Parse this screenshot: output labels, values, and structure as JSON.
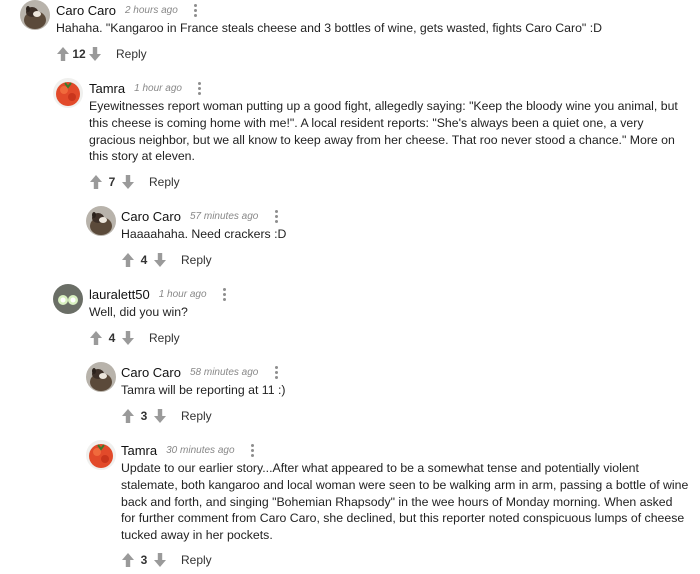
{
  "comments": [
    {
      "author": "Caro Caro",
      "time": "2 hours ago",
      "text": "Hahaha. \"Kangaroo in France steals cheese and 3 bottles of wine, gets wasted, fights Caro Caro\" :D",
      "votes": "12",
      "reply": "Reply",
      "avatar": "kangaroo-avatar"
    },
    {
      "author": "Tamra",
      "time": "1 hour ago",
      "text": "Eyewitnesses report woman putting up a good fight, allegedly saying: \"Keep the bloody wine you animal, but this cheese is coming home with me!\". A local resident reports: \"She's always been a quiet one, a very gracious neighbor, but we all know to keep away from her cheese. That roo never stood a chance.\" More on this story at eleven.",
      "votes": "7",
      "reply": "Reply",
      "avatar": "tomato-avatar"
    },
    {
      "author": "Caro Caro",
      "time": "57 minutes ago",
      "text": "Haaaahaha. Need crackers :D",
      "votes": "4",
      "reply": "Reply",
      "avatar": "kangaroo-avatar"
    },
    {
      "author": "lauralett50",
      "time": "1 hour ago",
      "text": "Well, did you win?",
      "votes": "4",
      "reply": "Reply",
      "avatar": "glowing-eyes-avatar"
    },
    {
      "author": "Caro Caro",
      "time": "58 minutes ago",
      "text": "Tamra will be reporting at 11 :)",
      "votes": "3",
      "reply": "Reply",
      "avatar": "kangaroo-avatar"
    },
    {
      "author": "Tamra",
      "time": "30 minutes ago",
      "text": "Update to our earlier story...After what appeared to be a somewhat tense and potentially violent stalemate, both kangaroo and local woman were seen to be walking arm in arm, passing a bottle of wine back and forth, and singing \"Bohemian Rhapsody\" in the wee hours of Monday morning. When asked for further comment from Caro Caro, she declined, but this reporter noted conspicuous lumps of cheese tucked away in her pockets.",
      "votes": "3",
      "reply": "Reply",
      "avatar": "tomato-avatar"
    }
  ],
  "icons": {
    "upvote": "arrow-up-icon",
    "downvote": "arrow-down-icon",
    "more": "more-options-icon"
  },
  "colors": {
    "icon": "#9a9a9a",
    "meta": "#888888",
    "text": "#222222"
  }
}
